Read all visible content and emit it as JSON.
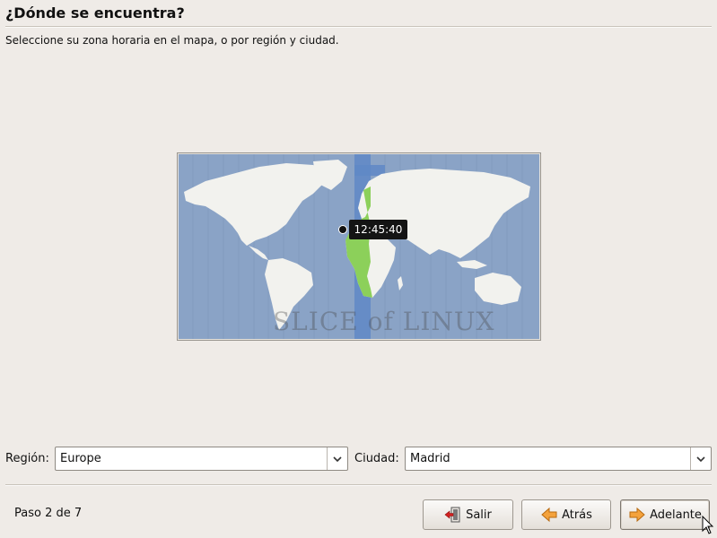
{
  "header": {
    "title": "¿Dónde se encuentra?",
    "subtitle": "Seleccione su zona horaria en el mapa, o por región y ciudad."
  },
  "map": {
    "time": "12:45:40",
    "watermark": "SLICE of LINUX",
    "colors": {
      "ocean": "#8aa3c6",
      "land": "#f2f2ee",
      "timezone": "#8cd05a",
      "highlight_band": "#5f88c6"
    }
  },
  "region": {
    "label": "Región:",
    "value": "Europe"
  },
  "city": {
    "label": "Ciudad:",
    "value": "Madrid"
  },
  "footer": {
    "step": "Paso 2 de 7",
    "quit_label": "Salir",
    "back_label": "Atrás",
    "forward_label": "Adelante"
  }
}
